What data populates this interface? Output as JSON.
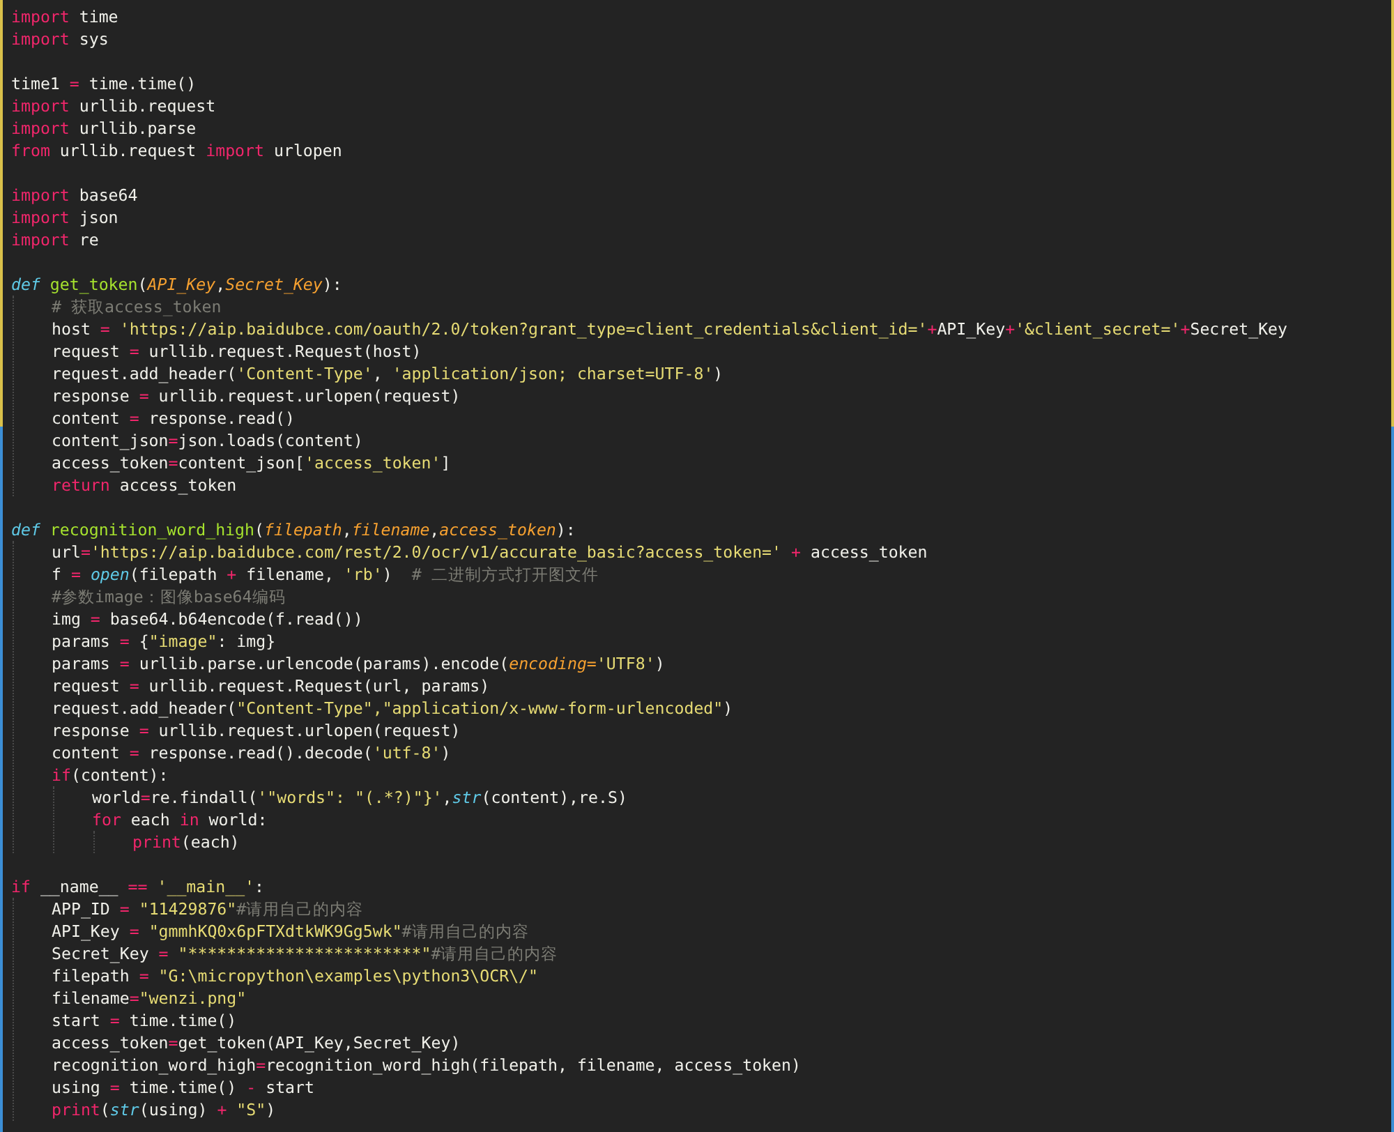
{
  "editor": {
    "sections": [
      {
        "lines": [
          {
            "tokens": [
              {
                "kind": "kw",
                "text": "import"
              },
              {
                "kind": "plain",
                "text": " time"
              }
            ]
          },
          {
            "tokens": [
              {
                "kind": "kw",
                "text": "import"
              },
              {
                "kind": "plain",
                "text": " sys"
              }
            ]
          }
        ]
      },
      {
        "lines": [
          {
            "tokens": [
              {
                "kind": "plain",
                "text": "time1 "
              },
              {
                "kind": "op",
                "text": "="
              },
              {
                "kind": "plain",
                "text": " time.time()"
              }
            ]
          },
          {
            "tokens": [
              {
                "kind": "kw",
                "text": "import"
              },
              {
                "kind": "plain",
                "text": " urllib.request"
              }
            ]
          },
          {
            "tokens": [
              {
                "kind": "kw",
                "text": "import"
              },
              {
                "kind": "plain",
                "text": " urllib.parse"
              }
            ]
          },
          {
            "tokens": [
              {
                "kind": "kw",
                "text": "from"
              },
              {
                "kind": "plain",
                "text": " urllib.request "
              },
              {
                "kind": "kw",
                "text": "import"
              },
              {
                "kind": "plain",
                "text": " urlopen"
              }
            ]
          }
        ]
      },
      {
        "lines": [
          {
            "tokens": [
              {
                "kind": "kw",
                "text": "import"
              },
              {
                "kind": "plain",
                "text": " base64"
              }
            ]
          },
          {
            "tokens": [
              {
                "kind": "kw",
                "text": "import"
              },
              {
                "kind": "plain",
                "text": " json"
              }
            ]
          },
          {
            "tokens": [
              {
                "kind": "kw",
                "text": "import"
              },
              {
                "kind": "plain",
                "text": " re"
              }
            ]
          }
        ]
      },
      {
        "lines": [
          {
            "tokens": [
              {
                "kind": "def",
                "text": "def "
              },
              {
                "kind": "fn",
                "text": "get_token"
              },
              {
                "kind": "plain",
                "text": "("
              },
              {
                "kind": "param",
                "text": "API_Key"
              },
              {
                "kind": "plain",
                "text": ","
              },
              {
                "kind": "param",
                "text": "Secret_Key"
              },
              {
                "kind": "plain",
                "text": "):"
              }
            ],
            "children": [
              {
                "tokens": [
                  {
                    "kind": "cm",
                    "text": "# 获取access_token"
                  }
                ]
              },
              {
                "tokens": [
                  {
                    "kind": "plain",
                    "text": "host "
                  },
                  {
                    "kind": "op",
                    "text": "= "
                  },
                  {
                    "kind": "str",
                    "text": "'https://aip.baidubce.com/oauth/2.0/token?grant_type=client_credentials&client_id='"
                  },
                  {
                    "kind": "op",
                    "text": "+"
                  },
                  {
                    "kind": "plain",
                    "text": "API_Key"
                  },
                  {
                    "kind": "op",
                    "text": "+"
                  },
                  {
                    "kind": "str",
                    "text": "'&client_secret='"
                  },
                  {
                    "kind": "op",
                    "text": "+"
                  },
                  {
                    "kind": "plain",
                    "text": "Secret_Key"
                  }
                ]
              },
              {
                "tokens": [
                  {
                    "kind": "plain",
                    "text": "request "
                  },
                  {
                    "kind": "op",
                    "text": "="
                  },
                  {
                    "kind": "plain",
                    "text": " urllib.request.Request(host)"
                  }
                ]
              },
              {
                "tokens": [
                  {
                    "kind": "plain",
                    "text": "request.add_header("
                  },
                  {
                    "kind": "str",
                    "text": "'Content-Type'"
                  },
                  {
                    "kind": "plain",
                    "text": ", "
                  },
                  {
                    "kind": "str",
                    "text": "'application/json; charset=UTF-8'"
                  },
                  {
                    "kind": "plain",
                    "text": ")"
                  }
                ]
              },
              {
                "tokens": [
                  {
                    "kind": "plain",
                    "text": "response "
                  },
                  {
                    "kind": "op",
                    "text": "="
                  },
                  {
                    "kind": "plain",
                    "text": " urllib.request.urlopen(request)"
                  }
                ]
              },
              {
                "tokens": [
                  {
                    "kind": "plain",
                    "text": "content "
                  },
                  {
                    "kind": "op",
                    "text": "="
                  },
                  {
                    "kind": "plain",
                    "text": " response.read()"
                  }
                ]
              },
              {
                "tokens": [
                  {
                    "kind": "plain",
                    "text": "content_json"
                  },
                  {
                    "kind": "op",
                    "text": "="
                  },
                  {
                    "kind": "plain",
                    "text": "json.loads(content)"
                  }
                ]
              },
              {
                "tokens": [
                  {
                    "kind": "plain",
                    "text": "access_token"
                  },
                  {
                    "kind": "op",
                    "text": "="
                  },
                  {
                    "kind": "plain",
                    "text": "content_json["
                  },
                  {
                    "kind": "str",
                    "text": "'access_token'"
                  },
                  {
                    "kind": "plain",
                    "text": "]"
                  }
                ]
              },
              {
                "tokens": [
                  {
                    "kind": "kw",
                    "text": "return"
                  },
                  {
                    "kind": "plain",
                    "text": " access_token"
                  }
                ]
              }
            ]
          }
        ]
      },
      {
        "lines": [
          {
            "tokens": [
              {
                "kind": "def",
                "text": "def "
              },
              {
                "kind": "fn",
                "text": "recognition_word_high"
              },
              {
                "kind": "plain",
                "text": "("
              },
              {
                "kind": "param",
                "text": "filepath"
              },
              {
                "kind": "plain",
                "text": ","
              },
              {
                "kind": "param",
                "text": "filename"
              },
              {
                "kind": "plain",
                "text": ","
              },
              {
                "kind": "param",
                "text": "access_token"
              },
              {
                "kind": "plain",
                "text": "):"
              }
            ],
            "children": [
              {
                "tokens": [
                  {
                    "kind": "plain",
                    "text": "url"
                  },
                  {
                    "kind": "op",
                    "text": "="
                  },
                  {
                    "kind": "str",
                    "text": "'https://aip.baidubce.com/rest/2.0/ocr/v1/accurate_basic?access_token='"
                  },
                  {
                    "kind": "op",
                    "text": " +"
                  },
                  {
                    "kind": "plain",
                    "text": " access_token"
                  }
                ]
              },
              {
                "tokens": [
                  {
                    "kind": "plain",
                    "text": "f "
                  },
                  {
                    "kind": "op",
                    "text": "= "
                  },
                  {
                    "kind": "bi",
                    "text": "open"
                  },
                  {
                    "kind": "plain",
                    "text": "(filepath "
                  },
                  {
                    "kind": "op",
                    "text": "+"
                  },
                  {
                    "kind": "plain",
                    "text": " filename, "
                  },
                  {
                    "kind": "str",
                    "text": "'rb'"
                  },
                  {
                    "kind": "plain",
                    "text": ")  "
                  },
                  {
                    "kind": "cm",
                    "text": "# 二进制方式打开图文件"
                  }
                ]
              },
              {
                "tokens": [
                  {
                    "kind": "cm",
                    "text": "#参数image：图像base64编码"
                  }
                ]
              },
              {
                "tokens": [
                  {
                    "kind": "plain",
                    "text": "img "
                  },
                  {
                    "kind": "op",
                    "text": "="
                  },
                  {
                    "kind": "plain",
                    "text": " base64.b64encode(f.read())"
                  }
                ]
              },
              {
                "tokens": [
                  {
                    "kind": "plain",
                    "text": "params "
                  },
                  {
                    "kind": "op",
                    "text": "="
                  },
                  {
                    "kind": "plain",
                    "text": " {"
                  },
                  {
                    "kind": "str",
                    "text": "\"image\""
                  },
                  {
                    "kind": "plain",
                    "text": ": img}"
                  }
                ]
              },
              {
                "tokens": [
                  {
                    "kind": "plain",
                    "text": "params "
                  },
                  {
                    "kind": "op",
                    "text": "="
                  },
                  {
                    "kind": "plain",
                    "text": " urllib.parse.urlencode(params).encode("
                  },
                  {
                    "kind": "param",
                    "text": "encoding="
                  },
                  {
                    "kind": "str",
                    "text": "'UTF8'"
                  },
                  {
                    "kind": "plain",
                    "text": ")"
                  }
                ]
              },
              {
                "tokens": [
                  {
                    "kind": "plain",
                    "text": "request "
                  },
                  {
                    "kind": "op",
                    "text": "="
                  },
                  {
                    "kind": "plain",
                    "text": " urllib.request.Request(url, params)"
                  }
                ]
              },
              {
                "tokens": [
                  {
                    "kind": "plain",
                    "text": "request.add_header("
                  },
                  {
                    "kind": "str",
                    "text": "\"Content-Type\","
                  },
                  {
                    "kind": "str",
                    "text": "\"application/x-www-form-urlencoded\""
                  },
                  {
                    "kind": "plain",
                    "text": ")"
                  }
                ]
              },
              {
                "tokens": [
                  {
                    "kind": "plain",
                    "text": "response "
                  },
                  {
                    "kind": "op",
                    "text": "="
                  },
                  {
                    "kind": "plain",
                    "text": " urllib.request.urlopen(request)"
                  }
                ]
              },
              {
                "tokens": [
                  {
                    "kind": "plain",
                    "text": "content "
                  },
                  {
                    "kind": "op",
                    "text": "="
                  },
                  {
                    "kind": "plain",
                    "text": " response.read().decode("
                  },
                  {
                    "kind": "str",
                    "text": "'utf-8'"
                  },
                  {
                    "kind": "plain",
                    "text": ")"
                  }
                ]
              },
              {
                "tokens": [
                  {
                    "kind": "kw",
                    "text": "if"
                  },
                  {
                    "kind": "plain",
                    "text": "(content):"
                  }
                ],
                "children": [
                  {
                    "tokens": [
                      {
                        "kind": "plain",
                        "text": "world"
                      },
                      {
                        "kind": "op",
                        "text": "="
                      },
                      {
                        "kind": "plain",
                        "text": "re.findall("
                      },
                      {
                        "kind": "str",
                        "text": "'\"words\": \"(.*?)\"}'"
                      },
                      {
                        "kind": "plain",
                        "text": ","
                      },
                      {
                        "kind": "bi",
                        "text": "str"
                      },
                      {
                        "kind": "plain",
                        "text": "(content),re.S)"
                      }
                    ]
                  },
                  {
                    "tokens": [
                      {
                        "kind": "kw",
                        "text": "for"
                      },
                      {
                        "kind": "plain",
                        "text": " each "
                      },
                      {
                        "kind": "kw",
                        "text": "in"
                      },
                      {
                        "kind": "plain",
                        "text": " world:"
                      }
                    ],
                    "children": [
                      {
                        "tokens": [
                          {
                            "kind": "kw",
                            "text": "print"
                          },
                          {
                            "kind": "plain",
                            "text": "(each)"
                          }
                        ]
                      }
                    ]
                  }
                ]
              }
            ]
          }
        ]
      },
      {
        "lines": [
          {
            "tokens": [
              {
                "kind": "kw",
                "text": "if"
              },
              {
                "kind": "plain",
                "text": " __name__ "
              },
              {
                "kind": "op",
                "text": "== "
              },
              {
                "kind": "str",
                "text": "'__main__'"
              },
              {
                "kind": "plain",
                "text": ":"
              }
            ],
            "children": [
              {
                "tokens": [
                  {
                    "kind": "plain",
                    "text": "APP_ID "
                  },
                  {
                    "kind": "op",
                    "text": "= "
                  },
                  {
                    "kind": "str",
                    "text": "\"11429876\""
                  },
                  {
                    "kind": "cm",
                    "text": "#请用自己的内容"
                  }
                ]
              },
              {
                "tokens": [
                  {
                    "kind": "plain",
                    "text": "API_Key "
                  },
                  {
                    "kind": "op",
                    "text": "= "
                  },
                  {
                    "kind": "str",
                    "text": "\"gmmhKQ0x6pFTXdtkWK9Gg5wk\""
                  },
                  {
                    "kind": "cm",
                    "text": "#请用自己的内容"
                  }
                ]
              },
              {
                "tokens": [
                  {
                    "kind": "plain",
                    "text": "Secret_Key "
                  },
                  {
                    "kind": "op",
                    "text": "= "
                  },
                  {
                    "kind": "str",
                    "text": "\"************************\""
                  },
                  {
                    "kind": "cm",
                    "text": "#请用自己的内容"
                  }
                ]
              },
              {
                "tokens": [
                  {
                    "kind": "plain",
                    "text": "filepath "
                  },
                  {
                    "kind": "op",
                    "text": "= "
                  },
                  {
                    "kind": "str",
                    "text": "\"G:\\micropython\\examples\\python3\\OCR\\/\""
                  }
                ]
              },
              {
                "tokens": [
                  {
                    "kind": "plain",
                    "text": "filename"
                  },
                  {
                    "kind": "op",
                    "text": "="
                  },
                  {
                    "kind": "str",
                    "text": "\"wenzi.png\""
                  }
                ]
              },
              {
                "tokens": [
                  {
                    "kind": "plain",
                    "text": "start "
                  },
                  {
                    "kind": "op",
                    "text": "="
                  },
                  {
                    "kind": "plain",
                    "text": " time.time()"
                  }
                ]
              },
              {
                "tokens": [
                  {
                    "kind": "plain",
                    "text": "access_token"
                  },
                  {
                    "kind": "op",
                    "text": "="
                  },
                  {
                    "kind": "plain",
                    "text": "get_token(API_Key,Secret_Key)"
                  }
                ]
              },
              {
                "tokens": [
                  {
                    "kind": "plain",
                    "text": "recognition_word_high"
                  },
                  {
                    "kind": "op",
                    "text": "="
                  },
                  {
                    "kind": "plain",
                    "text": "recognition_word_high(filepath, filename, access_token)"
                  }
                ]
              },
              {
                "tokens": [
                  {
                    "kind": "plain",
                    "text": "using "
                  },
                  {
                    "kind": "op",
                    "text": "="
                  },
                  {
                    "kind": "plain",
                    "text": " time.time() "
                  },
                  {
                    "kind": "op",
                    "text": "-"
                  },
                  {
                    "kind": "plain",
                    "text": " start"
                  }
                ]
              },
              {
                "tokens": [
                  {
                    "kind": "kw",
                    "text": "print"
                  },
                  {
                    "kind": "plain",
                    "text": "("
                  },
                  {
                    "kind": "bi",
                    "text": "str"
                  },
                  {
                    "kind": "plain",
                    "text": "(using) "
                  },
                  {
                    "kind": "op",
                    "text": "+ "
                  },
                  {
                    "kind": "str",
                    "text": "\"S\""
                  },
                  {
                    "kind": "plain",
                    "text": ")"
                  }
                ]
              }
            ]
          }
        ]
      }
    ]
  }
}
